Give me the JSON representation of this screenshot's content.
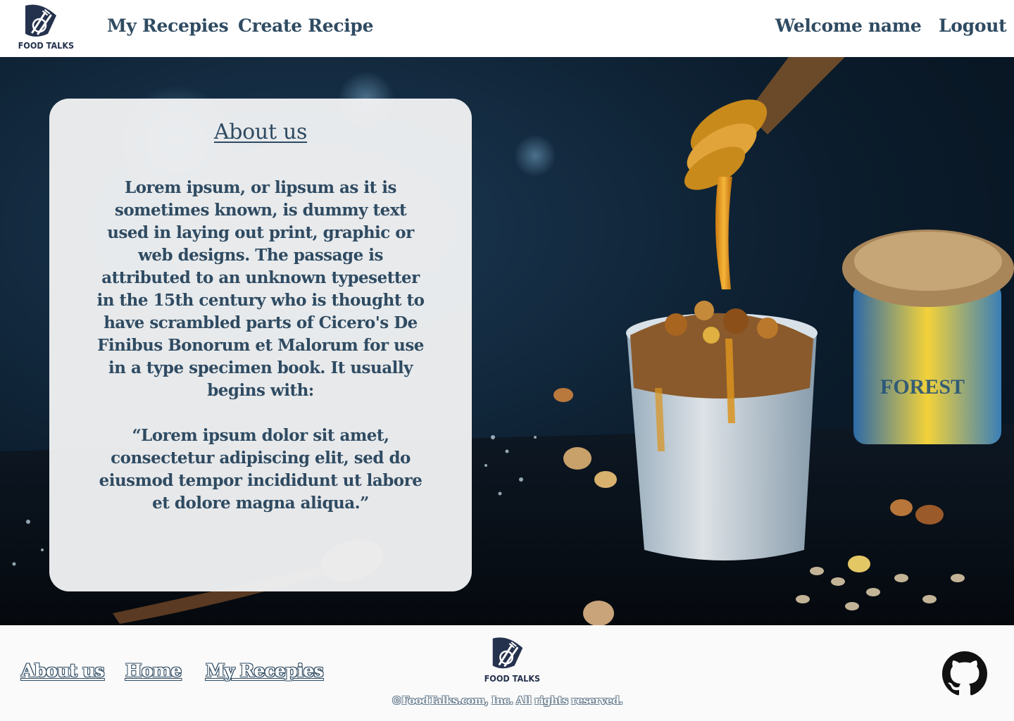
{
  "brand": {
    "name": "FOOD TALKS",
    "logo_icon": "plate-fork-knife-icon",
    "color": "#25324e"
  },
  "header": {
    "nav": [
      {
        "label": "My Recepies"
      },
      {
        "label": "Create Recipe"
      }
    ],
    "welcome": "Welcome name",
    "logout": "Logout"
  },
  "hero": {
    "image": "granola-yogurt-honey-dipper-photo"
  },
  "about": {
    "title": "About us",
    "body": "Lorem ipsum, or lipsum as it is sometimes known, is dummy text used in laying out print, graphic or web designs. The passage is attributed to an unknown typesetter in the 15th century who is thought to have scrambled parts of Cicero's De Finibus Bonorum et Malorum for use in a type specimen book. It usually begins with:",
    "quote": "“Lorem ipsum dolor sit amet, consectetur adipiscing elit, sed do eiusmod tempor incididunt ut labore et dolore magna aliqua.”"
  },
  "footer": {
    "links": [
      {
        "label": "About us"
      },
      {
        "label": "Home"
      },
      {
        "label": "My Recepies"
      }
    ],
    "copyright": "©FoodTalks.com, Inc. All rights reserved.",
    "github_icon": "github-icon"
  },
  "colors": {
    "text": "#2f4b62",
    "card": "#f0f1f3",
    "hero_dark": "#0b1c2c"
  }
}
